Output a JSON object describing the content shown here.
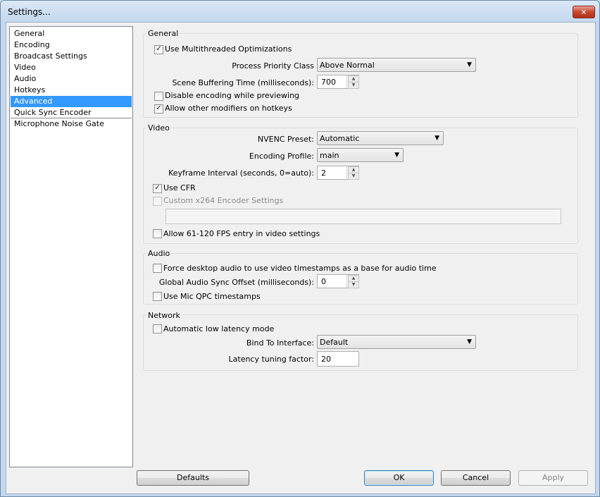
{
  "window": {
    "title": "Settings...",
    "close_glyph": "✕"
  },
  "sidebar": {
    "items": [
      {
        "label": "General"
      },
      {
        "label": "Encoding"
      },
      {
        "label": "Broadcast Settings"
      },
      {
        "label": "Video"
      },
      {
        "label": "Audio"
      },
      {
        "label": "Hotkeys"
      },
      {
        "label": "Advanced",
        "selected": true
      },
      {
        "label": "Quick Sync Encoder"
      },
      {
        "label": "Microphone Noise Gate"
      }
    ]
  },
  "general": {
    "title": "General",
    "multithreaded": {
      "label": "Use Multithreaded Optimizations",
      "checked": true
    },
    "priority": {
      "label": "Process Priority Class",
      "value": "Above Normal"
    },
    "buffering": {
      "label": "Scene Buffering Time (milliseconds):",
      "value": "700"
    },
    "disable_preview": {
      "label": "Disable encoding while previewing",
      "checked": false
    },
    "modifiers": {
      "label": "Allow other modifiers on hotkeys",
      "checked": true
    }
  },
  "video": {
    "title": "Video",
    "nvenc": {
      "label": "NVENC Preset:",
      "value": "Automatic"
    },
    "profile": {
      "label": "Encoding Profile:",
      "value": "main"
    },
    "keyframe": {
      "label": "Keyframe Interval (seconds, 0=auto):",
      "value": "2"
    },
    "cfr": {
      "label": "Use CFR",
      "checked": true
    },
    "custom_x264": {
      "label": "Custom x264 Encoder Settings",
      "checked": false,
      "disabled": true,
      "value": ""
    },
    "fps_entry": {
      "label": "Allow 61-120 FPS entry in video settings",
      "checked": false
    }
  },
  "audio": {
    "title": "Audio",
    "force_desktop": {
      "label": "Force desktop audio to use video timestamps as a base for audio time",
      "checked": false
    },
    "sync_offset": {
      "label": "Global Audio Sync Offset (milliseconds):",
      "value": "0"
    },
    "mic_qpc": {
      "label": "Use Mic QPC timestamps",
      "checked": false
    }
  },
  "network": {
    "title": "Network",
    "low_latency": {
      "label": "Automatic low latency mode",
      "checked": false
    },
    "bind": {
      "label": "Bind To Interface:",
      "value": "Default"
    },
    "latency_factor": {
      "label": "Latency tuning factor:",
      "value": "20"
    }
  },
  "buttons": {
    "defaults": "Defaults",
    "ok": "OK",
    "cancel": "Cancel",
    "apply": "Apply"
  },
  "glyphs": {
    "check": "✓",
    "arrow": "▼",
    "up": "▲",
    "down": "▼"
  }
}
